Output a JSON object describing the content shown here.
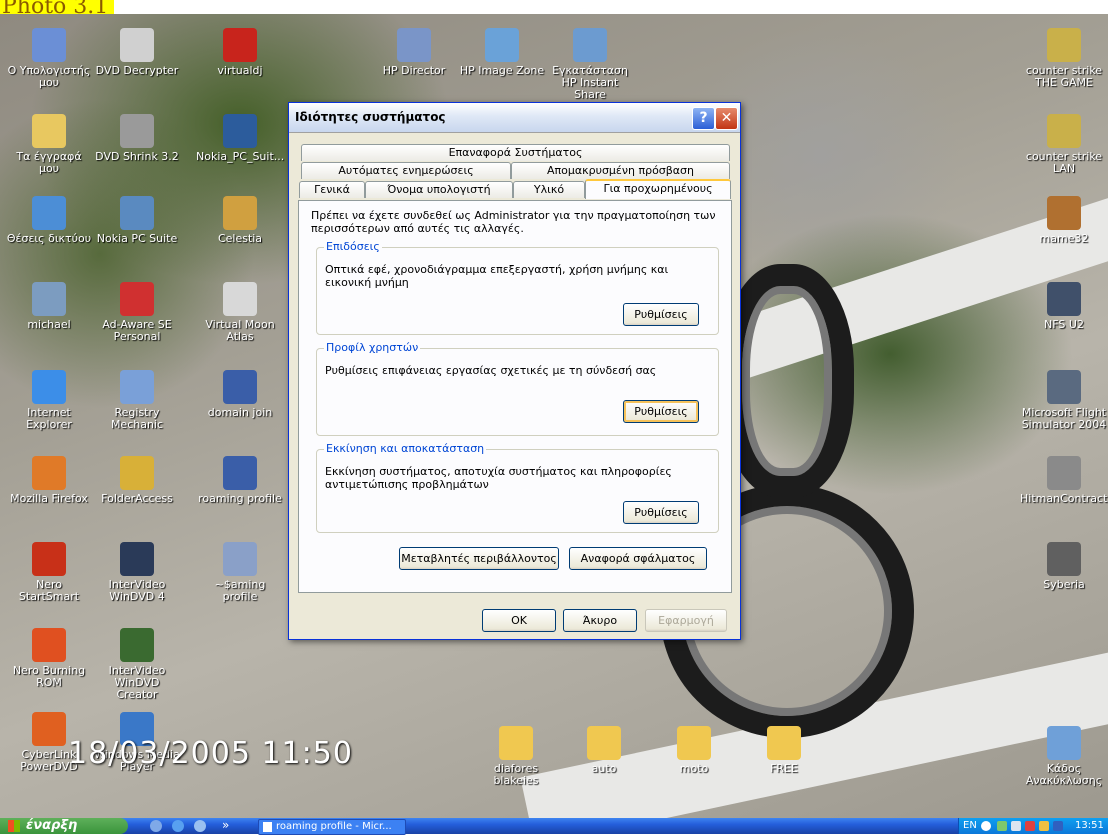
{
  "photo_label": "Photo 3.1",
  "date_stamp": "18/03/2005 11:50",
  "desktop_icons": [
    {
      "label": "Ο Υπολογιστής μου",
      "icon": "my-computer-icon",
      "color": "#6b8fd6"
    },
    {
      "label": "DVD Decrypter",
      "icon": "dvd-disc-icon",
      "color": "#d0d0d0"
    },
    {
      "label": "virtualdj",
      "icon": "virtualdj-icon",
      "color": "#c8241c"
    },
    {
      "label": "HP Director",
      "icon": "hp-director-icon",
      "color": "#7a95c8"
    },
    {
      "label": "HP Image Zone",
      "icon": "hp-image-zone-icon",
      "color": "#6aa2d8"
    },
    {
      "label": "Εγκατάσταση HP Instant Share",
      "icon": "hp-share-icon",
      "color": "#6c9bd0"
    },
    {
      "label": "counter strike THE GAME",
      "icon": "counter-strike-icon",
      "color": "#c9b04a"
    },
    {
      "label": "Τα έγγραφά μου",
      "icon": "my-documents-icon",
      "color": "#e8c860"
    },
    {
      "label": "DVD Shrink 3.2",
      "icon": "dvd-shrink-icon",
      "color": "#9a9a9a"
    },
    {
      "label": "Nokia_PC_Suit...",
      "icon": "nokia-suite-icon",
      "color": "#2c5c9c"
    },
    {
      "label": "counter strike LAN",
      "icon": "counter-strike-lan-icon",
      "color": "#c9b04a"
    },
    {
      "label": "Θέσεις δικτύου",
      "icon": "network-places-icon",
      "color": "#4c8ed6"
    },
    {
      "label": "Nokia PC Suite",
      "icon": "nokia-pc-suite-icon",
      "color": "#5a8ac0"
    },
    {
      "label": "Celestia",
      "icon": "celestia-icon",
      "color": "#d0a040"
    },
    {
      "label": "mame32",
      "icon": "mame32-icon",
      "color": "#b07030"
    },
    {
      "label": "michael",
      "icon": "user-folder-icon",
      "color": "#7c9cc0"
    },
    {
      "label": "Ad-Aware SE Personal",
      "icon": "ad-aware-icon",
      "color": "#d03030"
    },
    {
      "label": "Virtual Moon Atlas",
      "icon": "moon-icon",
      "color": "#d8d8d8"
    },
    {
      "label": "NFS U2",
      "icon": "nfs-icon",
      "color": "#40506a"
    },
    {
      "label": "Internet Explorer",
      "icon": "internet-explorer-icon",
      "color": "#3c8ee8"
    },
    {
      "label": "Registry Mechanic",
      "icon": "registry-mechanic-icon",
      "color": "#7aa0d8"
    },
    {
      "label": "domain join",
      "icon": "word-document-icon",
      "color": "#3a5ea8"
    },
    {
      "label": "Microsoft Flight Simulator 2004",
      "icon": "flight-simulator-icon",
      "color": "#5a6a80"
    },
    {
      "label": "Mozilla Firefox",
      "icon": "firefox-icon",
      "color": "#e07a28"
    },
    {
      "label": "FolderAccess",
      "icon": "folder-access-icon",
      "color": "#d8b038"
    },
    {
      "label": "roaming profile",
      "icon": "word-document-icon",
      "color": "#3a5ea8"
    },
    {
      "label": "HitmanContracts",
      "icon": "hitman-icon",
      "color": "#8a8a8a"
    },
    {
      "label": "Nero StartSmart",
      "icon": "nero-startsmart-icon",
      "color": "#c83018"
    },
    {
      "label": "InterVideo WinDVD 4",
      "icon": "windvd-icon",
      "color": "#2a3a58"
    },
    {
      "label": "~$aming profile",
      "icon": "word-temp-file-icon",
      "color": "#8aa0c8"
    },
    {
      "label": "Syberia",
      "icon": "syberia-icon",
      "color": "#606060"
    },
    {
      "label": "Nero Burning ROM",
      "icon": "nero-burning-icon",
      "color": "#e05020"
    },
    {
      "label": "InterVideo WinDVD Creator",
      "icon": "windvd-creator-icon",
      "color": "#3a6a30"
    },
    {
      "label": "CyberLink PowerDVD",
      "icon": "powerdvd-icon",
      "color": "#e06020"
    },
    {
      "label": "Windows Media Player",
      "icon": "media-player-icon",
      "color": "#3a78c8"
    },
    {
      "label": "diafores blakeies",
      "icon": "folder-icon",
      "color": "#f0c850"
    },
    {
      "label": "auto",
      "icon": "folder-icon",
      "color": "#f0c850"
    },
    {
      "label": "moto",
      "icon": "folder-icon",
      "color": "#f0c850"
    },
    {
      "label": "FREE",
      "icon": "folder-icon",
      "color": "#f0c850"
    },
    {
      "label": "Κάδος Ανακύκλωσης",
      "icon": "recycle-bin-icon",
      "color": "#6fa0d8"
    }
  ],
  "dialog": {
    "title": "Ιδιότητες συστήματος",
    "help_glyph": "?",
    "close_glyph": "✕",
    "tabs_row1": [
      "Επαναφορά Συστήματος"
    ],
    "tabs_row2": [
      "Αυτόματες ενημερώσεις",
      "Απομακρυσμένη πρόσβαση"
    ],
    "tabs_row3": [
      "Γενικά",
      "Όνομα υπολογιστή",
      "Υλικό",
      "Για προχωρημένους"
    ],
    "active_tab": "Για προχωρημένους",
    "intro": "Πρέπει να έχετε συνδεθεί ως Administrator για την πραγματοποίηση των περισσότερων από αυτές τις αλλαγές.",
    "groups": [
      {
        "title": "Επιδόσεις",
        "text": "Οπτικά εφέ, χρονοδιάγραμμα επεξεργαστή, χρήση μνήμης και εικονική μνήμη",
        "button": "Ρυθμίσεις"
      },
      {
        "title": "Προφίλ χρηστών",
        "text": "Ρυθμίσεις επιφάνειας εργασίας σχετικές με τη σύνδεσή σας",
        "button": "Ρυθμίσεις"
      },
      {
        "title": "Εκκίνηση και αποκατάσταση",
        "text": "Εκκίνηση συστήματος, αποτυχία συστήματος και πληροφορίες αντιμετώπισης προβλημάτων",
        "button": "Ρυθμίσεις"
      }
    ],
    "env_button": "Μεταβλητές περιβάλλοντος",
    "error_button": "Αναφορά σφάλματος",
    "ok": "OK",
    "cancel": "Άκυρο",
    "apply": "Εφαρμογή"
  },
  "taskbar": {
    "start_label": "έναρξη",
    "chevron": "»",
    "task_label": "roaming profile - Micr...",
    "lang": "EN",
    "time": "13:51"
  }
}
